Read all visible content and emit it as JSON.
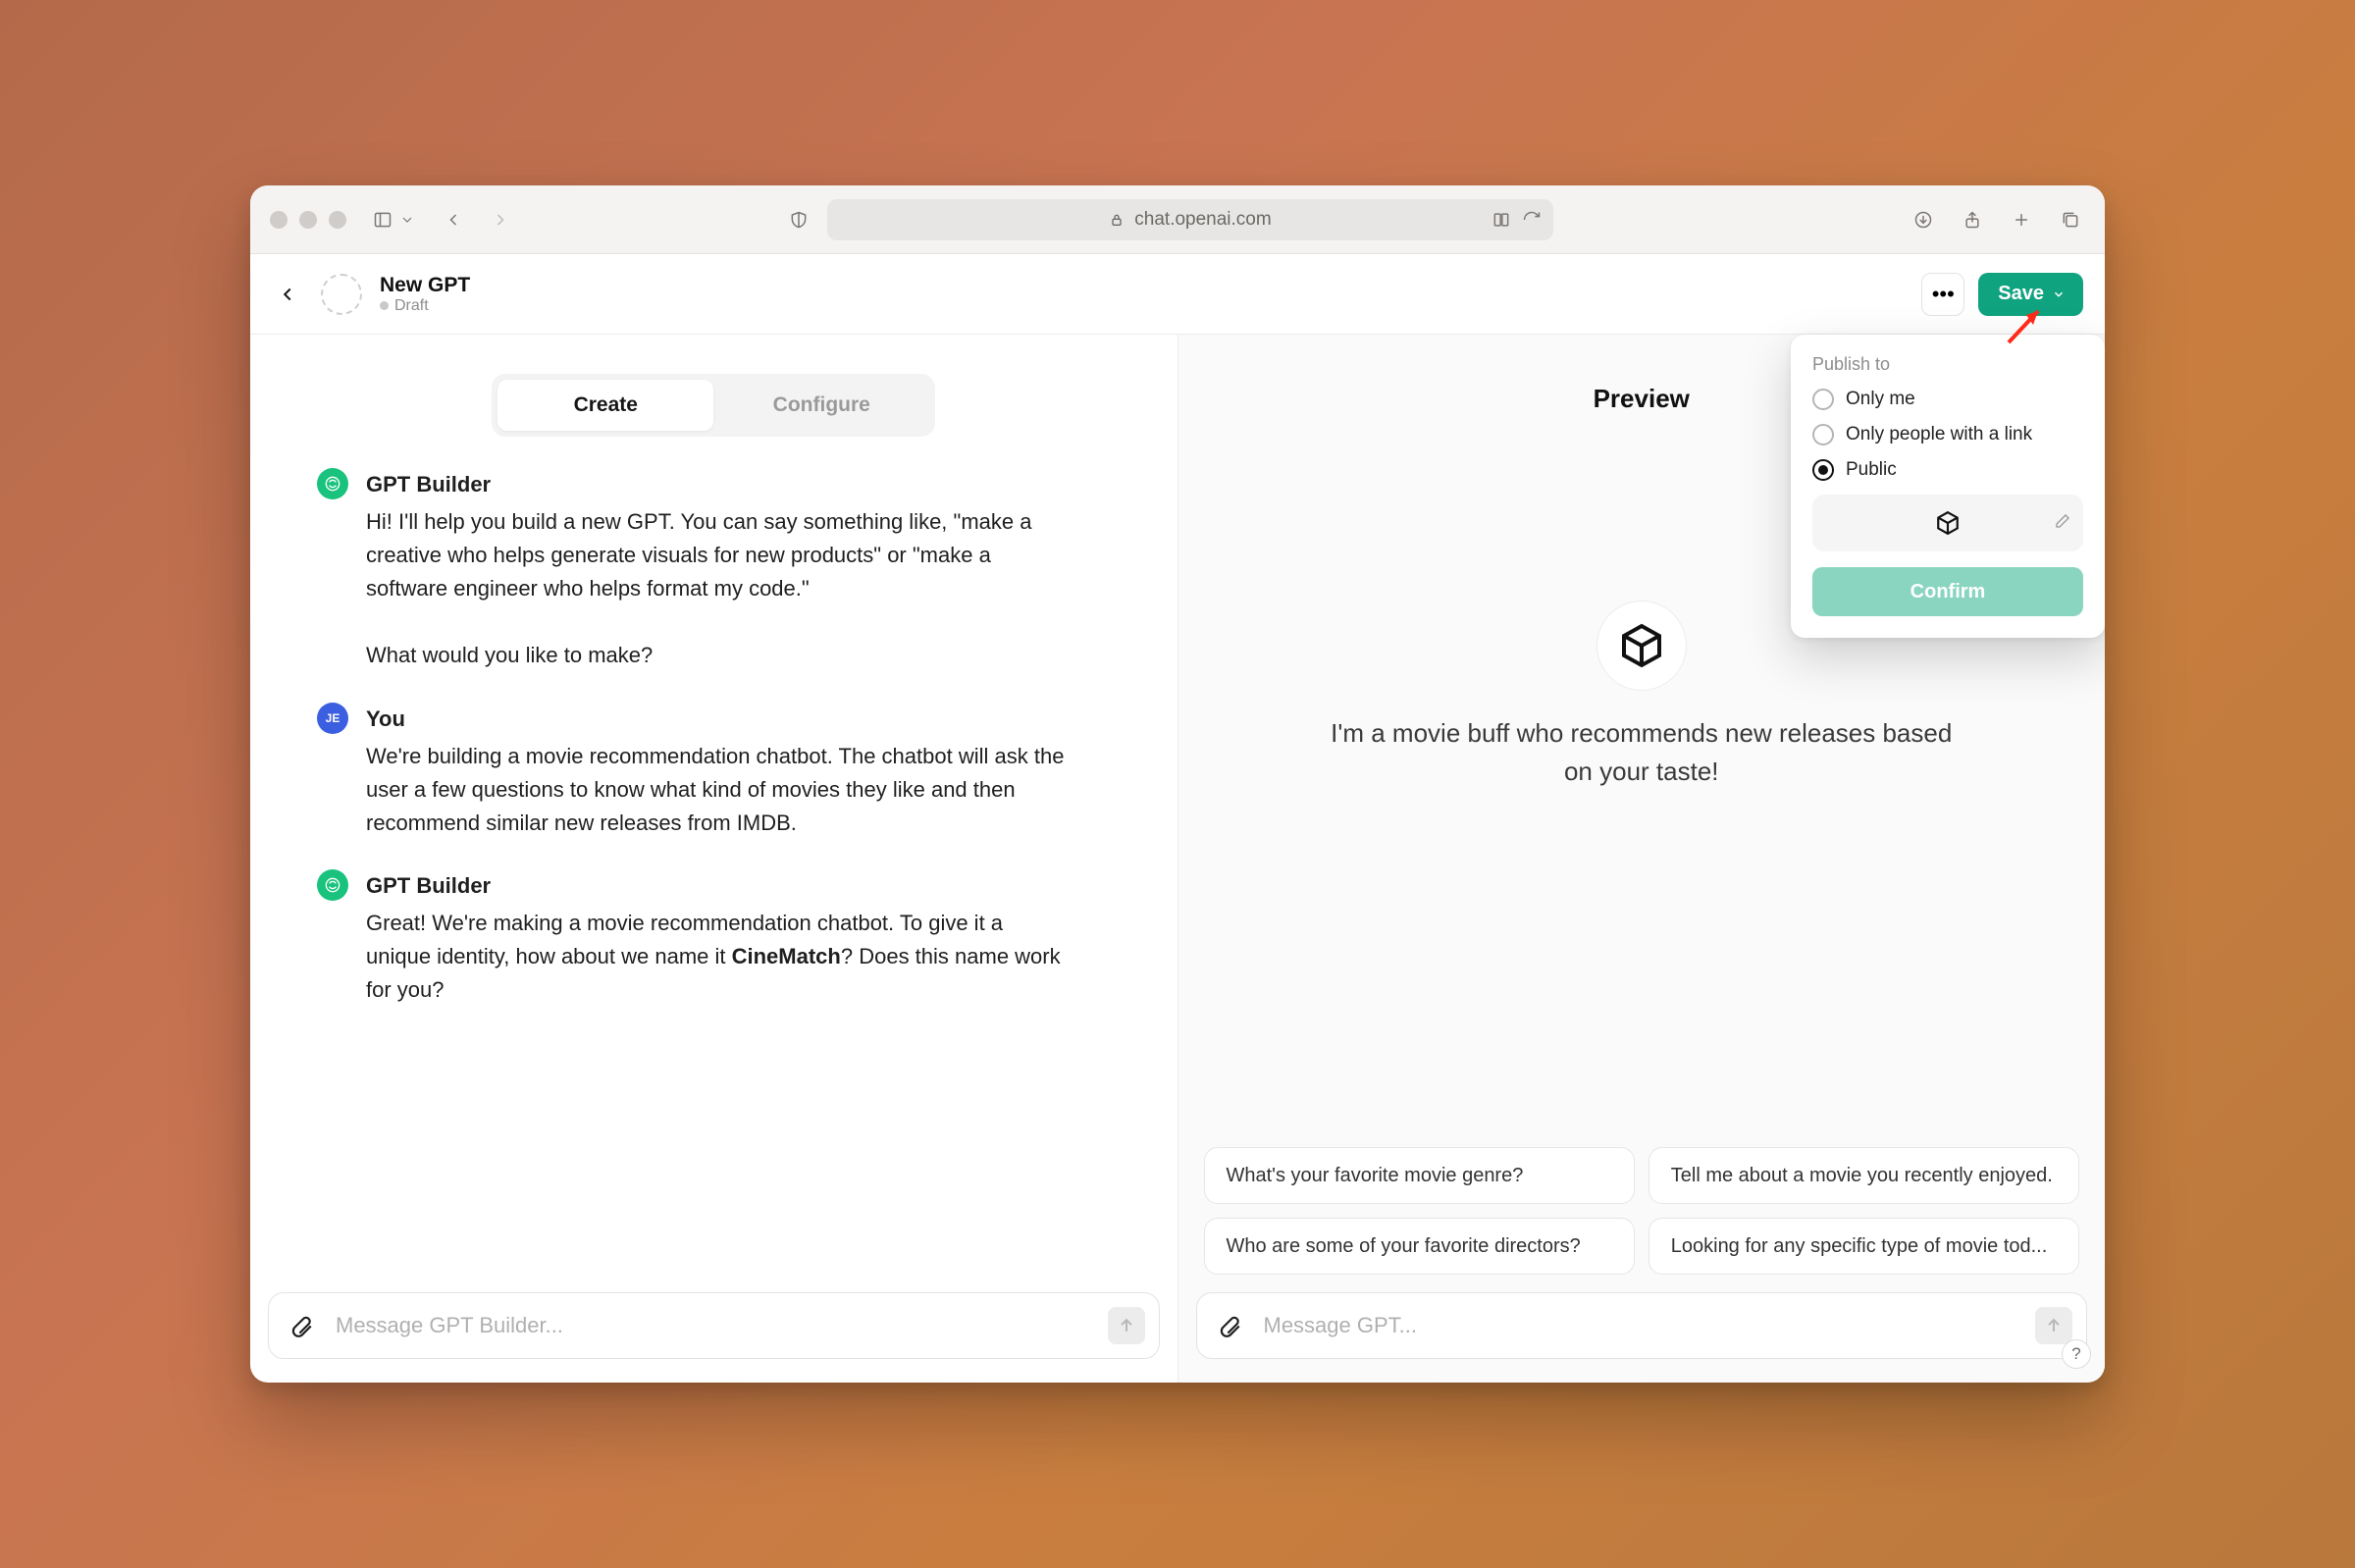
{
  "browser": {
    "url": "chat.openai.com"
  },
  "header": {
    "title": "New GPT",
    "status": "Draft",
    "save_label": "Save"
  },
  "tabs": {
    "create": "Create",
    "configure": "Configure"
  },
  "conversation": {
    "bot_name": "GPT Builder",
    "you_name": "You",
    "you_initials": "JE",
    "m1_p1": "Hi! I'll help you build a new GPT. You can say something like, \"make a creative who helps generate visuals for new products\" or \"make a software engineer who helps format my code.\"",
    "m1_p2": "What would you like to make?",
    "m2": "We're building a movie recommendation chatbot. The chatbot will ask the user a few questions to know what kind of movies they like and then recommend similar new releases from IMDB.",
    "m3_pre": "Great! We're making a movie recommendation chatbot. To give it a unique identity, how about we name it ",
    "m3_bold": "CineMatch",
    "m3_post": "? Does this name work for you?"
  },
  "left_input": {
    "placeholder": "Message GPT Builder..."
  },
  "preview": {
    "title": "Preview",
    "tagline": "I'm a movie buff who recommends new releases based on your taste!",
    "suggestions": [
      "What's your favorite movie genre?",
      "Tell me about a movie you recently enjoyed.",
      "Who are some of your favorite directors?",
      "Looking for any specific type of movie tod..."
    ],
    "input_placeholder": "Message GPT..."
  },
  "popover": {
    "heading": "Publish to",
    "opt1": "Only me",
    "opt2": "Only people with a link",
    "opt3": "Public",
    "confirm": "Confirm"
  },
  "help": "?"
}
